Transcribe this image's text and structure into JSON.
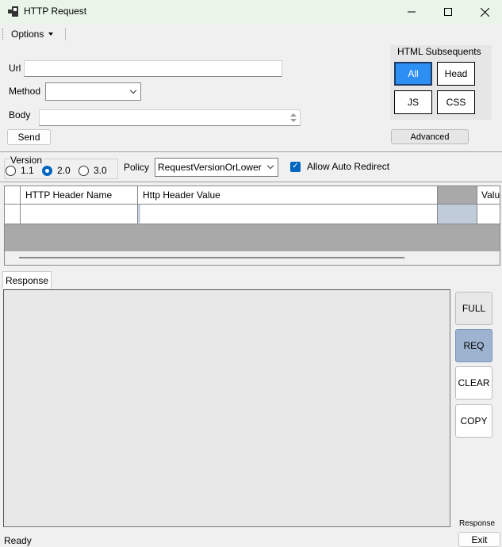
{
  "window": {
    "title": "HTTP Request",
    "minimize": "—",
    "maximize": "☐",
    "close": "✕"
  },
  "menu": {
    "options": "Options"
  },
  "form": {
    "url_label": "Url",
    "url_value": "",
    "method_label": "Method",
    "method_value": "",
    "body_label": "Body",
    "body_value": "",
    "send": "Send"
  },
  "html_subsequents": {
    "title": "HTML Subsequents",
    "all": "All",
    "head": "Head",
    "js": "JS",
    "css": "CSS",
    "active": "All",
    "advanced": "Advanced"
  },
  "version": {
    "title": "Version",
    "options": [
      "1.1",
      "2.0",
      "3.0"
    ],
    "selected": "2.0"
  },
  "policy": {
    "label": "Policy",
    "value": "RequestVersionOrLower"
  },
  "redirect": {
    "label": "Allow Auto Redirect",
    "checked": true
  },
  "headers_grid": {
    "columns": [
      "HTTP Header Name",
      "Http Header Value",
      "",
      "Valu"
    ]
  },
  "response": {
    "tab": "Response",
    "buttons": {
      "full": "FULL",
      "req": "REQ",
      "clear": "CLEAR",
      "copy": "COPY"
    },
    "footer_label": "Response"
  },
  "status": {
    "text": "Ready",
    "exit": "Exit"
  },
  "colors": {
    "accent": "#2d8ff3",
    "req_button": "#9db3d0",
    "titlebar": "#eaf5ea"
  }
}
